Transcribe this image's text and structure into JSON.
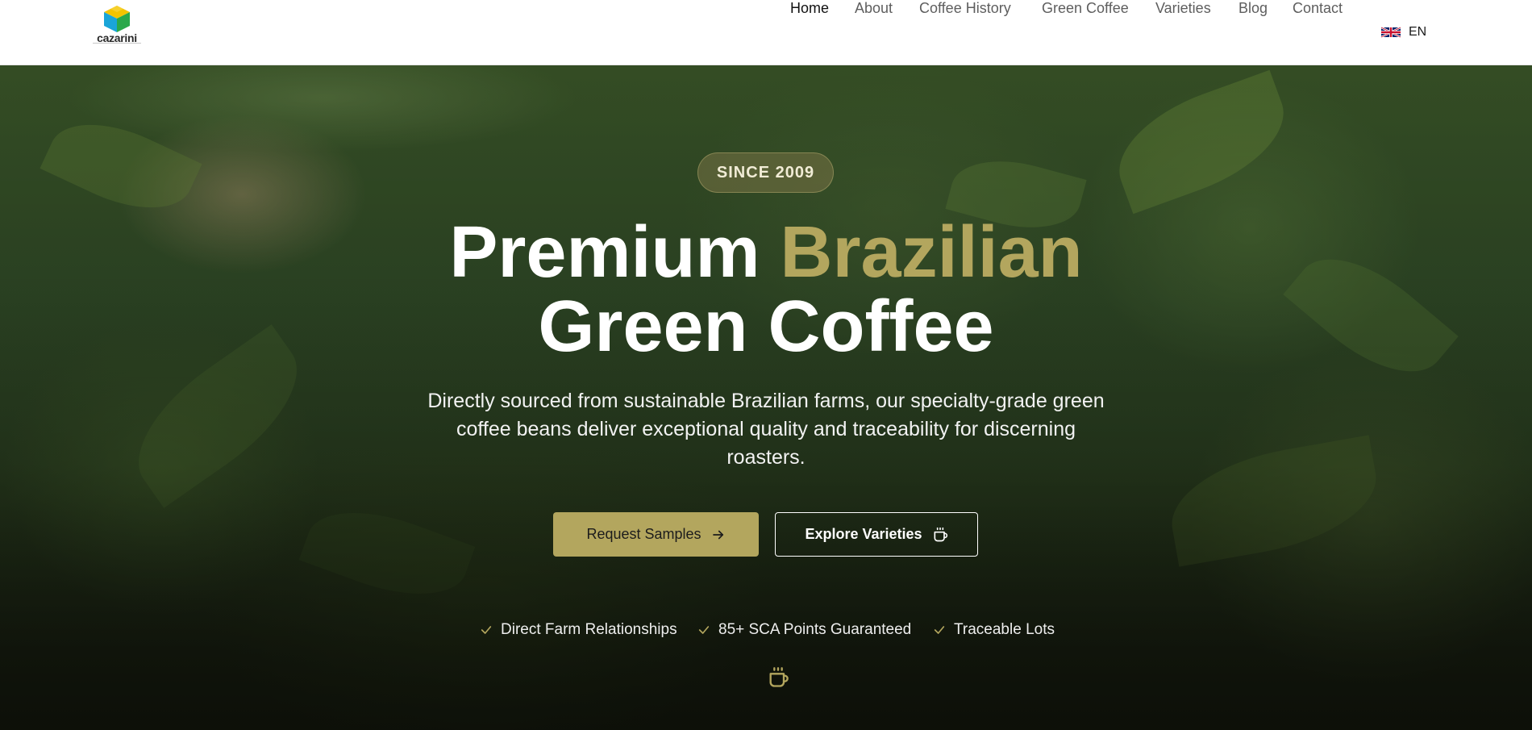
{
  "brand": {
    "name": "cazarini",
    "accent_color": "#b3a65e"
  },
  "nav": {
    "items": [
      {
        "label": "Home",
        "active": true
      },
      {
        "label": "About",
        "active": false
      },
      {
        "label": "Coffee History",
        "active": false
      },
      {
        "label": "Green Coffee",
        "active": false
      },
      {
        "label": "Varieties",
        "active": false
      },
      {
        "label": "Blog",
        "active": false
      },
      {
        "label": "Contact",
        "active": false
      }
    ],
    "language": {
      "label": "EN",
      "flag_icon": "uk-flag-icon"
    }
  },
  "hero": {
    "badge": "SINCE 2009",
    "headline_part1": "Premium",
    "headline_accent": "Brazilian",
    "headline_line2": "Green Coffee",
    "subtitle": "Directly sourced from sustainable Brazilian farms, our specialty-grade green coffee beans deliver exceptional quality and traceability for discerning roasters.",
    "primary_button": {
      "label": "Request Samples",
      "icon": "arrow-right-icon"
    },
    "secondary_button": {
      "label": "Explore Varieties",
      "icon": "coffee-cup-icon"
    },
    "features": [
      {
        "label": "Direct Farm Relationships",
        "icon": "check-icon"
      },
      {
        "label": "85+ SCA Points Guaranteed",
        "icon": "check-icon"
      },
      {
        "label": "Traceable Lots",
        "icon": "check-icon"
      }
    ],
    "scroll_icon": "coffee-cup-icon"
  }
}
